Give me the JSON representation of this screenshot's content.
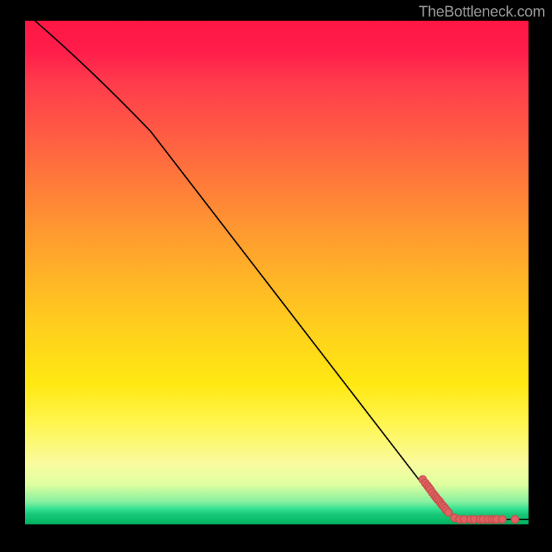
{
  "attribution": "TheBottleneck.com",
  "colors": {
    "page_bg": "#000000",
    "line": "#000000",
    "dot_fill": "#e06262",
    "dot_stroke": "#c94d4d",
    "attribution_text": "#9a9a9a"
  },
  "chart_data": {
    "type": "line",
    "title": "",
    "xlabel": "",
    "ylabel": "",
    "xlim": [
      0,
      100
    ],
    "ylim": [
      0,
      100
    ],
    "grid": false,
    "legend": null,
    "background_gradient": [
      {
        "pos": 0,
        "color": "#ff1744"
      },
      {
        "pos": 22,
        "color": "#ff5a44"
      },
      {
        "pos": 42,
        "color": "#ff9a30"
      },
      {
        "pos": 62,
        "color": "#ffd21c"
      },
      {
        "pos": 80,
        "color": "#fff650"
      },
      {
        "pos": 92,
        "color": "#e0ffa0"
      },
      {
        "pos": 97,
        "color": "#30e090"
      },
      {
        "pos": 100,
        "color": "#00b060"
      }
    ],
    "series": [
      {
        "name": "curve",
        "type": "line",
        "points": [
          {
            "x": 2,
            "y": 100
          },
          {
            "x": 25,
            "y": 78
          },
          {
            "x": 82,
            "y": 4
          },
          {
            "x": 86,
            "y": 1
          },
          {
            "x": 100,
            "y": 1
          }
        ]
      },
      {
        "name": "dots",
        "type": "scatter",
        "points": [
          {
            "x": 79.0,
            "y": 8.9
          },
          {
            "x": 79.5,
            "y": 8.2
          },
          {
            "x": 79.9,
            "y": 7.7
          },
          {
            "x": 80.2,
            "y": 7.3
          },
          {
            "x": 80.5,
            "y": 6.9
          },
          {
            "x": 80.9,
            "y": 6.3
          },
          {
            "x": 81.3,
            "y": 5.8
          },
          {
            "x": 81.6,
            "y": 5.4
          },
          {
            "x": 81.9,
            "y": 5.0
          },
          {
            "x": 82.2,
            "y": 4.7
          },
          {
            "x": 82.5,
            "y": 4.3
          },
          {
            "x": 82.8,
            "y": 3.9
          },
          {
            "x": 83.1,
            "y": 3.6
          },
          {
            "x": 83.4,
            "y": 3.2
          },
          {
            "x": 83.7,
            "y": 2.8
          },
          {
            "x": 84.1,
            "y": 2.4
          },
          {
            "x": 85.3,
            "y": 1.3
          },
          {
            "x": 86.3,
            "y": 1.0
          },
          {
            "x": 87.2,
            "y": 1.0
          },
          {
            "x": 88.5,
            "y": 1.0
          },
          {
            "x": 89.2,
            "y": 1.0
          },
          {
            "x": 90.4,
            "y": 1.0
          },
          {
            "x": 91.0,
            "y": 1.0
          },
          {
            "x": 92.0,
            "y": 1.0
          },
          {
            "x": 92.7,
            "y": 1.0
          },
          {
            "x": 93.2,
            "y": 1.0
          },
          {
            "x": 93.7,
            "y": 1.0
          },
          {
            "x": 94.8,
            "y": 1.0
          },
          {
            "x": 97.3,
            "y": 1.0
          }
        ]
      }
    ]
  }
}
